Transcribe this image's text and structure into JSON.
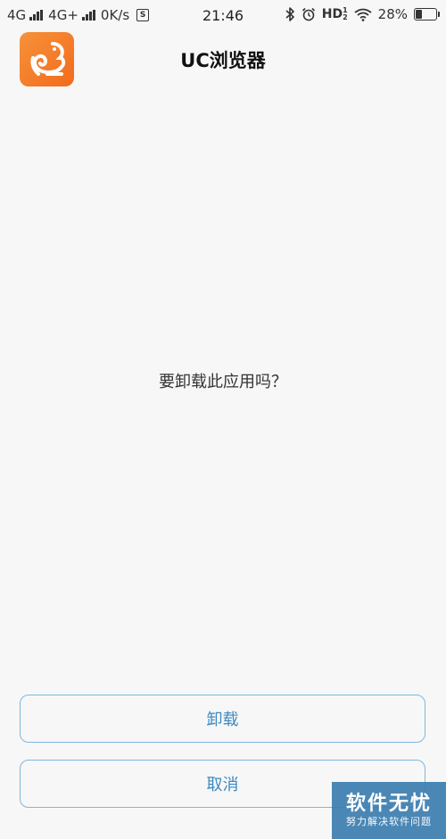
{
  "status_bar": {
    "network1": "4G",
    "network2": "4G+",
    "speed": "0K/s",
    "sim_icon_glyph": "S",
    "time": "21:46",
    "hd": "HD",
    "hd_sup": "1",
    "hd_sub": "2",
    "battery_text": "28%",
    "battery_level": 0.28,
    "icons": [
      "signal-icon",
      "sim-icon",
      "bluetooth-icon",
      "alarm-icon",
      "wifi-icon",
      "battery-icon"
    ]
  },
  "header": {
    "app_name": "UC浏览器",
    "app_icon": "uc-browser-squirrel-icon",
    "app_icon_color": "#f47d2a"
  },
  "dialog": {
    "message": "要卸载此应用吗？"
  },
  "buttons": {
    "uninstall_label": "卸载",
    "cancel_label": "取消",
    "accent_color": "#3d89c2"
  },
  "watermark": {
    "main": "软件无忧",
    "sub": "努力解决软件问题"
  }
}
